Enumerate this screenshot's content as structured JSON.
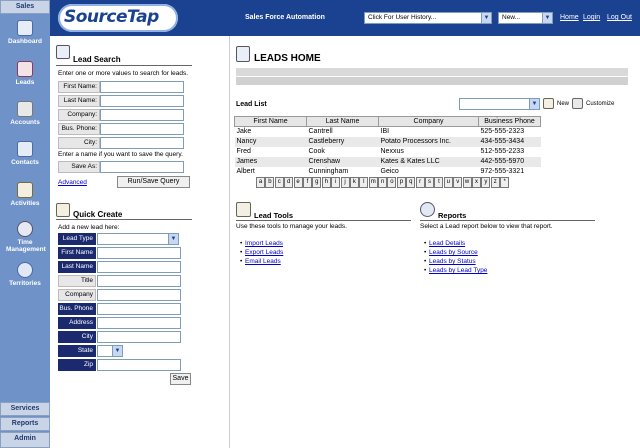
{
  "nav": {
    "header": "Sales",
    "items": [
      {
        "label": "Dashboard",
        "icon": "dashboard-icon"
      },
      {
        "label": "Leads",
        "icon": "leads-icon"
      },
      {
        "label": "Accounts",
        "icon": "accounts-icon"
      },
      {
        "label": "Contacts",
        "icon": "contacts-icon"
      },
      {
        "label": "Activities",
        "icon": "activities-icon"
      },
      {
        "label": "Time Management",
        "icon": "time-icon"
      },
      {
        "label": "Territories",
        "icon": "territories-icon"
      }
    ],
    "bottom": [
      "Services",
      "Reports",
      "Admin"
    ]
  },
  "header": {
    "logo": "SourceTap",
    "subtitle": "Sales Force Automation",
    "history_select": "Click For User History...",
    "new_select": "New...",
    "links": [
      "Home",
      "Login",
      "Log Out"
    ]
  },
  "lead_search": {
    "title": "Lead Search",
    "instructions": "Enter one or more values to search for leads.",
    "fields": [
      "First Name:",
      "Last Name:",
      "Company:",
      "Bus. Phone:",
      "City:"
    ],
    "save_instructions": "Enter a name if you want to save the query.",
    "save_label": "Save As:",
    "advanced_link": "Advanced",
    "run_button": "Run/Save Query"
  },
  "quick_create": {
    "title": "Quick Create",
    "instructions": "Add a new lead here:",
    "fields": [
      "Lead Type",
      "First Name",
      "Last Name",
      "Title",
      "Company",
      "Bus. Phone",
      "Address",
      "City",
      "State",
      "Zip"
    ],
    "save_button": "Save"
  },
  "main": {
    "title": "LEADS HOME",
    "lead_list_label": "Lead List",
    "new_label": "New",
    "customize_label": "Customize",
    "columns": [
      "First Name",
      "Last Name",
      "Company",
      "Business Phone"
    ],
    "rows": [
      [
        "Jake",
        "Cantrell",
        "IBI",
        "525-555-2323"
      ],
      [
        "Nancy",
        "Castleberry",
        "Potato Processors Inc.",
        "434-555-3434"
      ],
      [
        "Fred",
        "Cook",
        "Nexxus",
        "512-555-2233"
      ],
      [
        "James",
        "Crenshaw",
        "Kates & Kates LLC",
        "442-555-5970"
      ],
      [
        "Albert",
        "Cunningham",
        "Geico",
        "972-555-3321"
      ]
    ],
    "alphabet": [
      "a",
      "b",
      "c",
      "d",
      "e",
      "f",
      "g",
      "h",
      "i",
      "j",
      "k",
      "l",
      "m",
      "n",
      "o",
      "p",
      "q",
      "r",
      "s",
      "t",
      "u",
      "v",
      "w",
      "x",
      "y",
      "z",
      "*"
    ]
  },
  "lead_tools": {
    "title": "Lead Tools",
    "description": "Use these tools to manage your leads.",
    "links": [
      "Import Leads",
      "Export Leads",
      "Email Leads"
    ]
  },
  "reports": {
    "title": "Reports",
    "description": "Select a Lead report below to view that report.",
    "links": [
      "Lead Details",
      "Leads by Source",
      "Leads by Status",
      "Leads by Lead Type"
    ]
  },
  "colors": {
    "nav_bg": "#6f93c9",
    "header_bg": "#1b4290",
    "label_dark": "#1b2a6e"
  }
}
